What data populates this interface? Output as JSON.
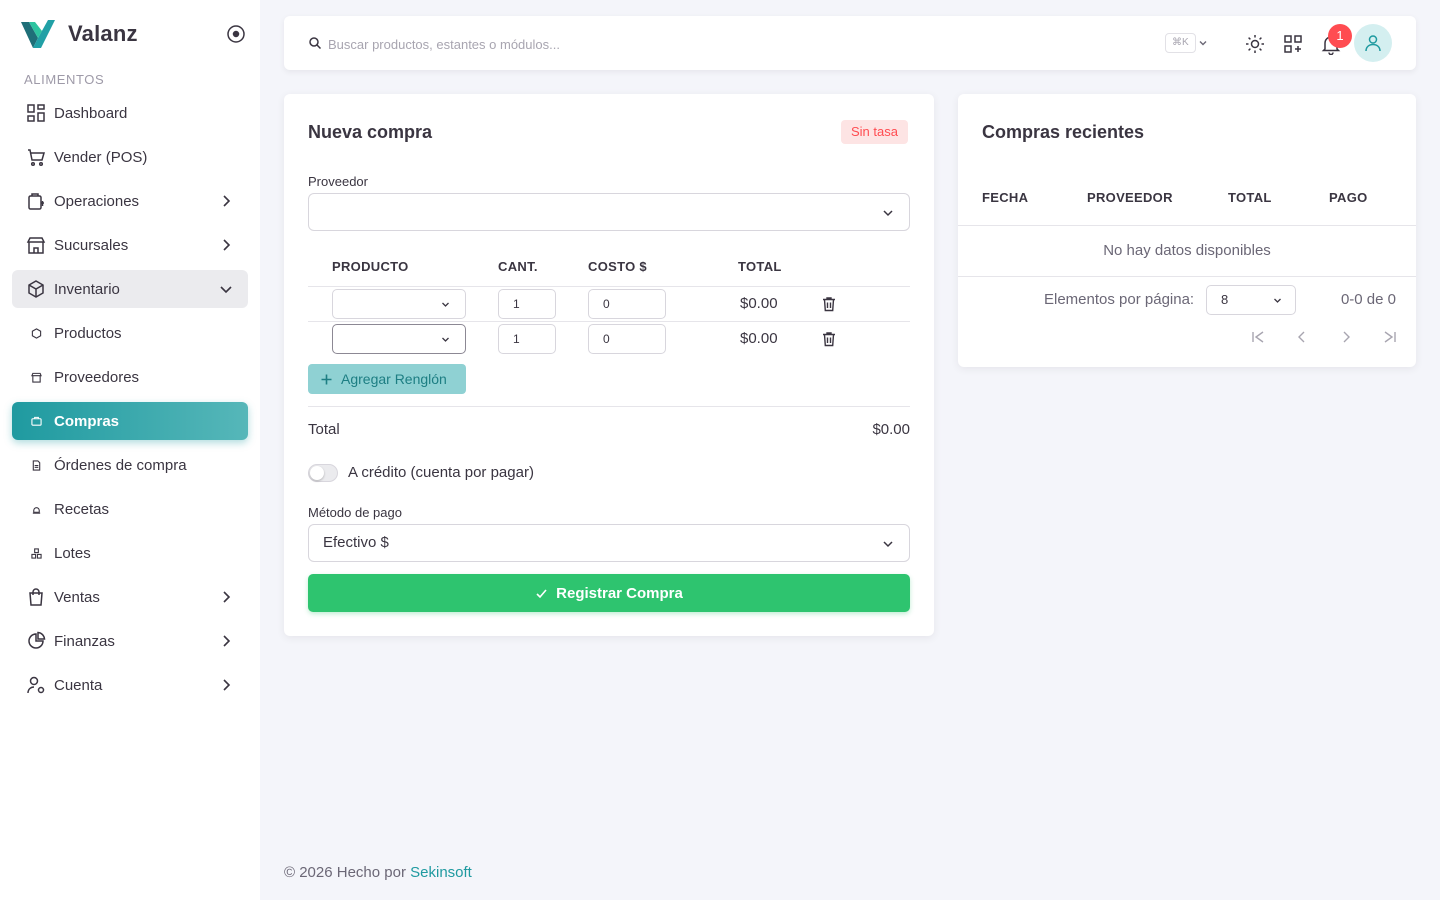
{
  "brand": {
    "name": "Valanz"
  },
  "sidebar": {
    "section": "ALIMENTOS",
    "items": [
      {
        "label": "Dashboard",
        "icon": "dashboard-icon",
        "arrow": ""
      },
      {
        "label": "Vender (POS)",
        "icon": "cart-icon",
        "arrow": ""
      },
      {
        "label": "Operaciones",
        "icon": "operations-icon",
        "arrow": "right"
      },
      {
        "label": "Sucursales",
        "icon": "store-icon",
        "arrow": "right"
      },
      {
        "label": "Inventario",
        "icon": "box-icon",
        "arrow": "down"
      },
      {
        "label": "Productos",
        "icon": "product-icon",
        "arrow": ""
      },
      {
        "label": "Proveedores",
        "icon": "supplier-icon",
        "arrow": ""
      },
      {
        "label": "Compras",
        "icon": "purchase-icon",
        "arrow": ""
      },
      {
        "label": "Órdenes de compra",
        "icon": "order-icon",
        "arrow": ""
      },
      {
        "label": "Recetas",
        "icon": "recipe-icon",
        "arrow": ""
      },
      {
        "label": "Lotes",
        "icon": "batch-icon",
        "arrow": ""
      },
      {
        "label": "Ventas",
        "icon": "bag-icon",
        "arrow": "right"
      },
      {
        "label": "Finanzas",
        "icon": "pie-chart-icon",
        "arrow": "right"
      },
      {
        "label": "Cuenta",
        "icon": "user-settings-icon",
        "arrow": "right"
      }
    ]
  },
  "topbar": {
    "search_placeholder": "Buscar productos, estantes o módulos...",
    "shortcut": "⌘K",
    "notification_count": "1"
  },
  "purchase": {
    "title": "Nueva compra",
    "rate_badge": "Sin tasa",
    "supplier_label": "Proveedor",
    "supplier_value": "",
    "columns": {
      "product": "PRODUCTO",
      "qty": "CANT.",
      "cost": "COSTO $",
      "total": "TOTAL"
    },
    "rows": [
      {
        "product": "",
        "qty": "1",
        "cost": "0",
        "total": "$0.00"
      },
      {
        "product": "",
        "qty": "1",
        "cost": "0",
        "total": "$0.00"
      }
    ],
    "add_row_label": "Agregar Renglón",
    "total_label": "Total",
    "total_value": "$0.00",
    "credit_label": "A crédito (cuenta por pagar)",
    "credit_on": false,
    "payment_label": "Método de pago",
    "payment_value": "Efectivo $",
    "submit_label": "Registrar Compra"
  },
  "recent": {
    "title": "Compras recientes",
    "columns": {
      "date": "FECHA",
      "supplier": "PROVEEDOR",
      "total": "TOTAL",
      "payment": "PAGO"
    },
    "empty_message": "No hay datos disponibles",
    "per_page_label": "Elementos por página:",
    "per_page_value": "8",
    "range": "0-0 de 0"
  },
  "footer": {
    "text": "© 2026 Hecho por",
    "link": "Sekinsoft"
  },
  "colors": {
    "primary": "#1f9aa0",
    "success": "#2ec46f",
    "danger": "#ff4c51"
  }
}
